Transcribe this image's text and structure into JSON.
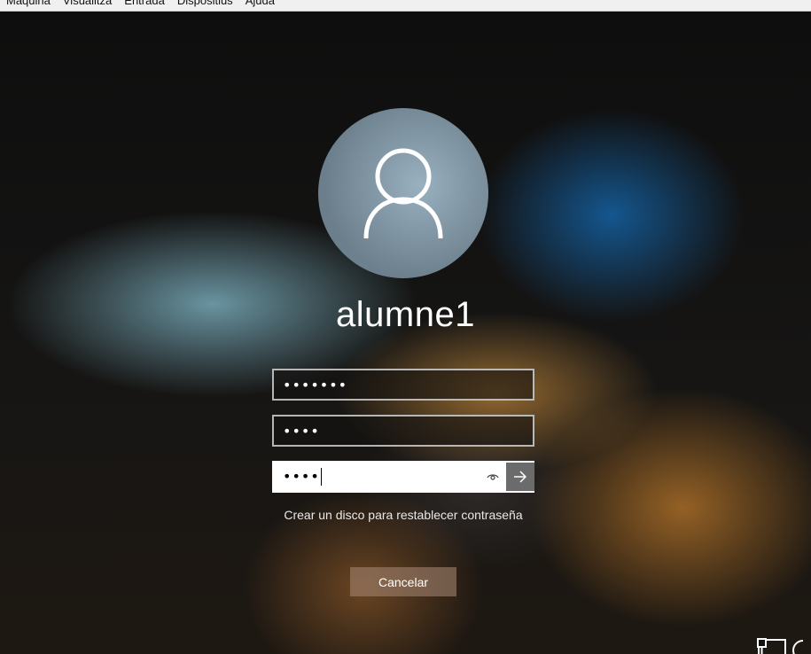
{
  "menubar": {
    "items": [
      "Màquina",
      "Visualitza",
      "Entrada",
      "Dispositius",
      "Ajuda"
    ]
  },
  "login": {
    "username": "alumne1",
    "fields": [
      {
        "value": "•••••••"
      },
      {
        "value": "••••"
      },
      {
        "value": "••••"
      }
    ],
    "reveal_icon": "eye-icon",
    "submit_icon": "arrow-right-icon",
    "reset_link": "Crear un disco para restablecer contraseña",
    "cancel_label": "Cancelar"
  },
  "corner_icons": [
    "network-icon",
    "power-icon"
  ]
}
